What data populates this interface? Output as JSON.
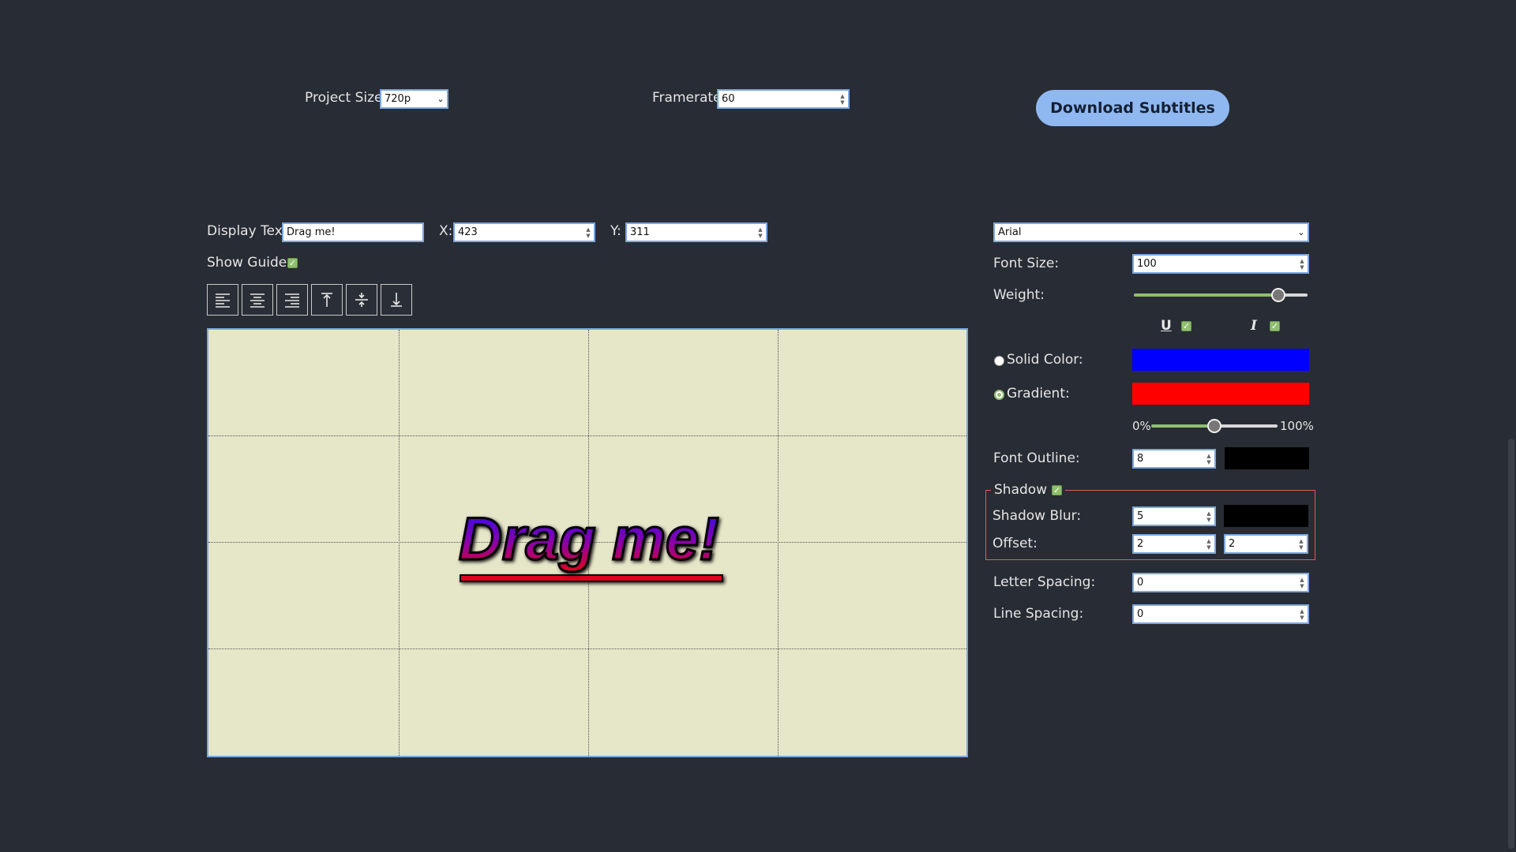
{
  "top": {
    "project_size_label": "Project Size:",
    "project_size_value": "720p",
    "framerate_label": "Framerate:",
    "framerate_value": "60",
    "download_label": "Download Subtitles"
  },
  "editor": {
    "display_text_label": "Display Text:",
    "display_text_value": "Drag me!",
    "x_label": "X:",
    "x_value": "423",
    "y_label": "Y:",
    "y_value": "311",
    "show_guides_label": "Show Guides:",
    "show_guides_checked": true,
    "align_buttons": [
      "align-left",
      "align-center",
      "align-right",
      "align-top",
      "align-middle",
      "align-bottom"
    ],
    "canvas_text": "Drag me!"
  },
  "style": {
    "font_value": "Arial",
    "font_size_label": "Font Size:",
    "font_size_value": "100",
    "weight_label": "Weight:",
    "weight_level": 0.83,
    "underline_checked": true,
    "italic_checked": true,
    "solid_color_label": "Solid Color:",
    "solid_color": "#0000ff",
    "gradient_label": "Gradient:",
    "gradient_color": "#ff0000",
    "gradient_selected": true,
    "gradient_min_label": "0%",
    "gradient_max_label": "100%",
    "gradient_level": 0.5,
    "outline_label": "Font Outline:",
    "outline_value": "8",
    "outline_color": "#000000",
    "shadow_label": "Shadow",
    "shadow_checked": true,
    "shadow_blur_label": "Shadow Blur:",
    "shadow_blur_value": "5",
    "shadow_color": "#000000",
    "offset_label": "Offset:",
    "offset_x_value": "2",
    "offset_y_value": "2",
    "letter_spacing_label": "Letter Spacing:",
    "letter_spacing_value": "0",
    "line_spacing_label": "Line Spacing:",
    "line_spacing_value": "0"
  },
  "colors": {
    "background": "#282c34",
    "canvas": "#e6e6c8",
    "accent_button": "#8fb8f0",
    "check_green": "#8fbf6f"
  }
}
